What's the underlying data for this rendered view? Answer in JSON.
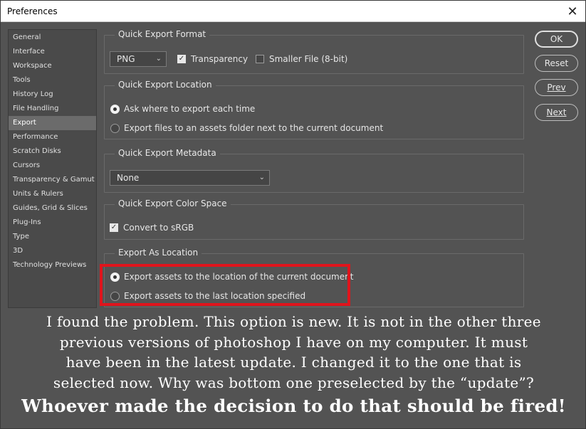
{
  "window": {
    "title": "Preferences",
    "close_glyph": "✕"
  },
  "sidebar": {
    "items": [
      {
        "label": "General"
      },
      {
        "label": "Interface"
      },
      {
        "label": "Workspace"
      },
      {
        "label": "Tools"
      },
      {
        "label": "History Log"
      },
      {
        "label": "File Handling"
      },
      {
        "label": "Export",
        "selected": true
      },
      {
        "label": "Performance"
      },
      {
        "label": "Scratch Disks"
      },
      {
        "label": "Cursors"
      },
      {
        "label": "Transparency & Gamut"
      },
      {
        "label": "Units & Rulers"
      },
      {
        "label": "Guides, Grid & Slices"
      },
      {
        "label": "Plug-Ins"
      },
      {
        "label": "Type"
      },
      {
        "label": "3D"
      },
      {
        "label": "Technology Previews"
      }
    ]
  },
  "format_group": {
    "title": "Quick Export Format",
    "format_value": "PNG",
    "transparency_label": "Transparency",
    "transparency_checked": true,
    "smaller_file_label": "Smaller File (8-bit)",
    "smaller_file_checked": false
  },
  "location_group": {
    "title": "Quick Export Location",
    "option_ask": "Ask where to export each time",
    "option_assets": "Export files to an assets folder next to the current document",
    "selected": "ask"
  },
  "metadata_group": {
    "title": "Quick Export Metadata",
    "value": "None"
  },
  "colorspace_group": {
    "title": "Quick Export Color Space",
    "convert_label": "Convert to sRGB",
    "convert_checked": true
  },
  "export_as_group": {
    "title": "Export As Location",
    "option_current": "Export assets to the location of the current document",
    "option_last": "Export assets to the last location specified",
    "selected": "current"
  },
  "buttons": {
    "ok": "OK",
    "reset": "Reset",
    "prev": "Prev",
    "next": "Next"
  },
  "icons": {
    "chevron": "chevron-down-icon",
    "check": "✓"
  },
  "colors": {
    "highlight": "#e0141c",
    "panel_bg": "#535353"
  },
  "caption": {
    "line1": "I found the problem. This option is new. It is not in the other three",
    "line2": "previous versions of photoshop I have on my computer. It must",
    "line3": "have been in the latest update. I changed it to the one that is",
    "line4": "selected now. Why was bottom one preselected by the “update”?",
    "line5": "Whoever made the decision to do that should be fired!"
  }
}
